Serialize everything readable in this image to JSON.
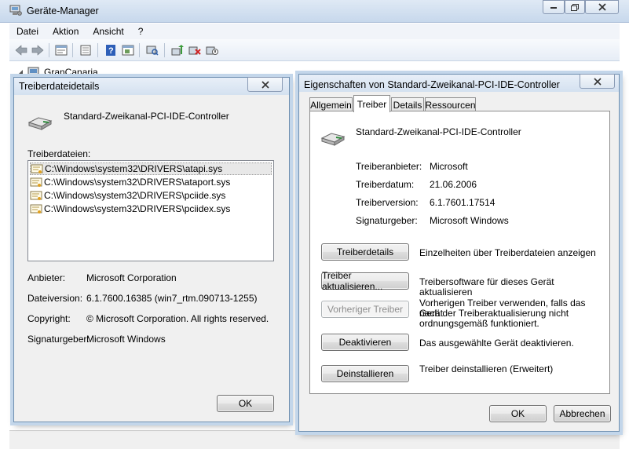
{
  "main": {
    "title": "Geräte-Manager",
    "menu": [
      "Datei",
      "Aktion",
      "Ansicht",
      "?"
    ],
    "toolbar_icons": [
      "back-icon",
      "forward-icon",
      "properties-icon",
      "view-icon",
      "help-icon",
      "devices-view-icon",
      "scan-hardware-icon",
      "update-driver-icon",
      "uninstall-icon",
      "disable-icon"
    ],
    "tree_root": "GranCanaria"
  },
  "driver_details": {
    "title": "Treiberdateidetails",
    "device_name": "Standard-Zweikanal-PCI-IDE-Controller",
    "files_label": "Treiberdateien:",
    "files": [
      "C:\\Windows\\system32\\DRIVERS\\atapi.sys",
      "C:\\Windows\\system32\\DRIVERS\\ataport.sys",
      "C:\\Windows\\system32\\DRIVERS\\pciide.sys",
      "C:\\Windows\\system32\\DRIVERS\\pciidex.sys"
    ],
    "info": [
      {
        "label": "Anbieter:",
        "value": "Microsoft Corporation"
      },
      {
        "label": "Dateiversion:",
        "value": "6.1.7600.16385 (win7_rtm.090713-1255)"
      },
      {
        "label": "Copyright:",
        "value": "© Microsoft Corporation. All rights reserved."
      },
      {
        "label": "Signaturgeber:",
        "value": "Microsoft Windows"
      }
    ],
    "ok_label": "OK"
  },
  "properties": {
    "title": "Eigenschaften von Standard-Zweikanal-PCI-IDE-Controller",
    "tabs": [
      "Allgemein",
      "Treiber",
      "Details",
      "Ressourcen"
    ],
    "active_tab": "Treiber",
    "device_name": "Standard-Zweikanal-PCI-IDE-Controller",
    "info": [
      {
        "label": "Treiberanbieter:",
        "value": "Microsoft"
      },
      {
        "label": "Treiberdatum:",
        "value": "21.06.2006"
      },
      {
        "label": "Treiberversion:",
        "value": "6.1.7601.17514"
      },
      {
        "label": "Signaturgeber:",
        "value": "Microsoft Windows"
      }
    ],
    "actions": [
      {
        "button": "Treiberdetails",
        "description": "Einzelheiten über Treiberdateien anzeigen",
        "enabled": true
      },
      {
        "button": "Treiber aktualisieren...",
        "description": "Treibersoftware für dieses Gerät aktualisieren",
        "enabled": true
      },
      {
        "button": "Vorheriger Treiber",
        "description_lines": [
          "Vorherigen Treiber verwenden, falls das Gerät",
          "nach der Treiberaktualisierung nicht",
          "ordnungsgemäß funktioniert."
        ],
        "enabled": false
      },
      {
        "button": "Deaktivieren",
        "description": "Das ausgewählte Gerät deaktivieren.",
        "enabled": true
      },
      {
        "button": "Deinstallieren",
        "description": "Treiber deinstallieren (Erweitert)",
        "enabled": true
      }
    ],
    "ok_label": "OK",
    "cancel_label": "Abbrechen"
  },
  "colors": {
    "titlebar": "#d4e1f0",
    "dialog_bg": "#f0f0f0",
    "disabled_text": "#8d8d8d"
  }
}
